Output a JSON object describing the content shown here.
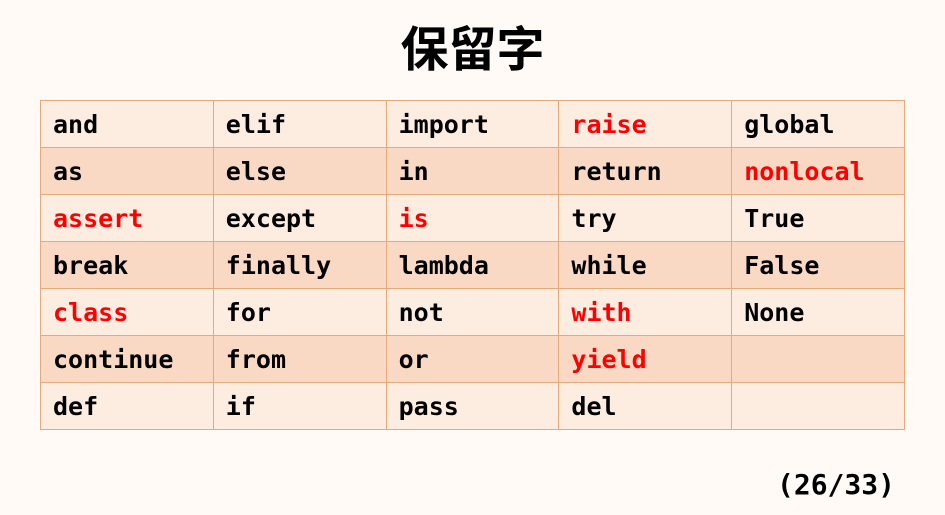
{
  "title": "保留字",
  "pager": "(26/33)",
  "columns": 5,
  "rows": [
    [
      {
        "t": "and"
      },
      {
        "t": "elif"
      },
      {
        "t": "import"
      },
      {
        "t": "raise",
        "hl": true
      },
      {
        "t": "global"
      }
    ],
    [
      {
        "t": "as"
      },
      {
        "t": "else"
      },
      {
        "t": "in"
      },
      {
        "t": "return"
      },
      {
        "t": "nonlocal",
        "hl": true
      }
    ],
    [
      {
        "t": "assert",
        "hl": true
      },
      {
        "t": "except"
      },
      {
        "t": "is",
        "hl": true
      },
      {
        "t": "try"
      },
      {
        "t": "True"
      }
    ],
    [
      {
        "t": "break"
      },
      {
        "t": "finally"
      },
      {
        "t": "lambda"
      },
      {
        "t": "while"
      },
      {
        "t": "False"
      }
    ],
    [
      {
        "t": "class",
        "hl": true
      },
      {
        "t": "for"
      },
      {
        "t": "not"
      },
      {
        "t": "with",
        "hl": true
      },
      {
        "t": "None"
      }
    ],
    [
      {
        "t": "continue"
      },
      {
        "t": "from"
      },
      {
        "t": "or"
      },
      {
        "t": "yield",
        "hl": true
      },
      {
        "t": ""
      }
    ],
    [
      {
        "t": "def"
      },
      {
        "t": "if"
      },
      {
        "t": "pass"
      },
      {
        "t": "del"
      },
      {
        "t": ""
      }
    ]
  ]
}
